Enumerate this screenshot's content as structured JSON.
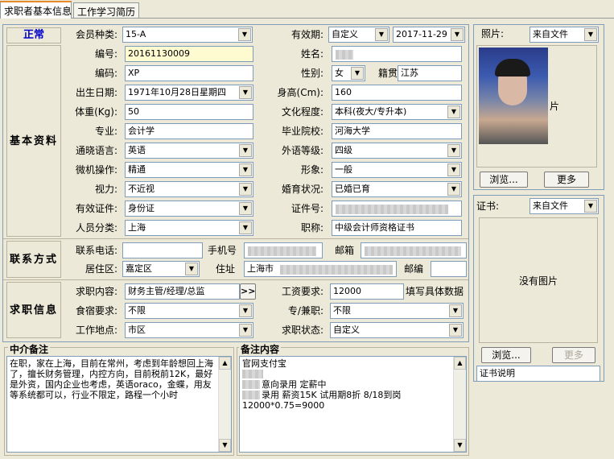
{
  "tabs": [
    {
      "label": "求职者基本信息"
    },
    {
      "label": "工作学习简历"
    }
  ],
  "status": "正常",
  "sections": {
    "basic": "基本资料",
    "contact": "联系方式",
    "job": "求职信息"
  },
  "fields": {
    "member_type": {
      "label": "会员种类:",
      "value": "15-A"
    },
    "validity": {
      "label": "有效期:",
      "value": "自定义",
      "date": "2017-11-29"
    },
    "number": {
      "label": "编号:",
      "value": "20161130009"
    },
    "name": {
      "label": "姓名:",
      "value": ""
    },
    "code": {
      "label": "编码:",
      "value": "XP"
    },
    "gender": {
      "label": "性别:",
      "value": "女"
    },
    "native": {
      "label": "籍贯",
      "value": "江苏"
    },
    "birthday": {
      "label": "出生日期:",
      "value": "1971年10月28日星期四"
    },
    "height": {
      "label": "身高(Cm):",
      "value": "160"
    },
    "weight": {
      "label": "体重(Kg):",
      "value": "50"
    },
    "education": {
      "label": "文化程度:",
      "value": "本科(夜大/专升本)"
    },
    "major": {
      "label": "专业:",
      "value": "会计学"
    },
    "school": {
      "label": "毕业院校:",
      "value": "河海大学"
    },
    "language": {
      "label": "通晓语言:",
      "value": "英语"
    },
    "lang_level": {
      "label": "外语等级:",
      "value": "四级"
    },
    "computer": {
      "label": "微机操作:",
      "value": "精通"
    },
    "appearance": {
      "label": "形象:",
      "value": "一般"
    },
    "vision": {
      "label": "视力:",
      "value": "不近视"
    },
    "marital": {
      "label": "婚育状况:",
      "value": "已婚已育"
    },
    "id_type": {
      "label": "有效证件:",
      "value": "身份证"
    },
    "id_no": {
      "label": "证件号:",
      "value": ""
    },
    "category": {
      "label": "人员分类:",
      "value": "上海"
    },
    "title": {
      "label": "职称:",
      "value": "中级会计师资格证书"
    },
    "phone": {
      "label": "联系电话:",
      "value": ""
    },
    "mobile": {
      "label": "手机号",
      "value": ""
    },
    "email": {
      "label": "邮箱",
      "value": ""
    },
    "district": {
      "label": "居住区:",
      "value": "嘉定区"
    },
    "address": {
      "label": "住址",
      "value": "上海市"
    },
    "postcode": {
      "label": "邮编",
      "value": ""
    },
    "job_content": {
      "label": "求职内容:",
      "value": "财务主管/经理/总监",
      "btn": ">>"
    },
    "salary": {
      "label": "工资要求:",
      "value": "12000",
      "hint": "填写具体数据"
    },
    "board": {
      "label": "食宿要求:",
      "value": "不限"
    },
    "parttime": {
      "label": "专/兼职:",
      "value": "不限"
    },
    "location": {
      "label": "工作地点:",
      "value": "市区"
    },
    "job_status": {
      "label": "求职状态:",
      "value": "自定义"
    }
  },
  "photo": {
    "label": "照片:",
    "source": "来自文件",
    "browse": "浏览...",
    "more": "更多",
    "overflow": "片"
  },
  "cert": {
    "label": "证书:",
    "source": "来自文件",
    "no_image": "没有图片",
    "browse": "浏览...",
    "more": "更多",
    "desc": "证书说明"
  },
  "notes": {
    "agency_title": "中介备注",
    "agency_text": "在职，家在上海，目前在常州，考虑到年龄想回上海了，擅长财务管理，内控方向，目前税前12K，最好是外资，国内企业也考虑，英语oraco，金蝶，用友等系统都可以，行业不限定，路程一个小时",
    "remark_title": "备注内容",
    "remark_lines": [
      "官网支付宝",
      "意向录用  定薪中",
      "录用 薪资15K 试用期8折  8/18到岗",
      "12000*0.75=9000"
    ]
  }
}
